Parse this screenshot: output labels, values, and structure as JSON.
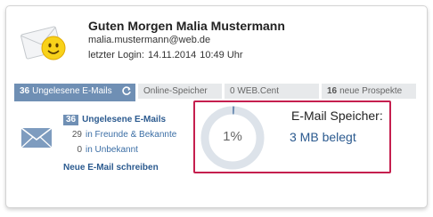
{
  "user": {
    "greeting": "Guten Morgen Malia Mustermann",
    "email": "malia.mustermann@web.de",
    "last_login_label": "letzter Login:",
    "last_login_date": "14.11.2014",
    "last_login_time": "10:49 Uhr"
  },
  "tabs": [
    {
      "count": "36",
      "label": "Ungelesene E-Mails",
      "active": true
    },
    {
      "count": "",
      "label": "Online-Speicher",
      "active": false
    },
    {
      "count": "0",
      "label": "WEB.Cent",
      "active": false
    },
    {
      "count": "16",
      "label": "neue Prospekte",
      "active": false
    }
  ],
  "mail": {
    "unread_count": "36",
    "unread_label": "Ungelesene E-Mails",
    "friends_count": "29",
    "friends_label": "in Freunde & Bekannte",
    "unknown_count": "0",
    "unknown_label": "in Unbekannt",
    "new_mail_label": "Neue E-Mail schreiben"
  },
  "storage": {
    "title": "E-Mail Speicher:",
    "used": "3 MB belegt",
    "percent_label": "1%",
    "percent_value": 1
  },
  "colors": {
    "accent": "#6f8fb4",
    "link": "#2b5a8f",
    "highlight_border": "#c51f4e",
    "donut_track": "#dde3ea"
  },
  "icons": {
    "avatar": "smiley-envelope-icon",
    "refresh": "refresh-icon",
    "mail": "envelope-icon"
  }
}
